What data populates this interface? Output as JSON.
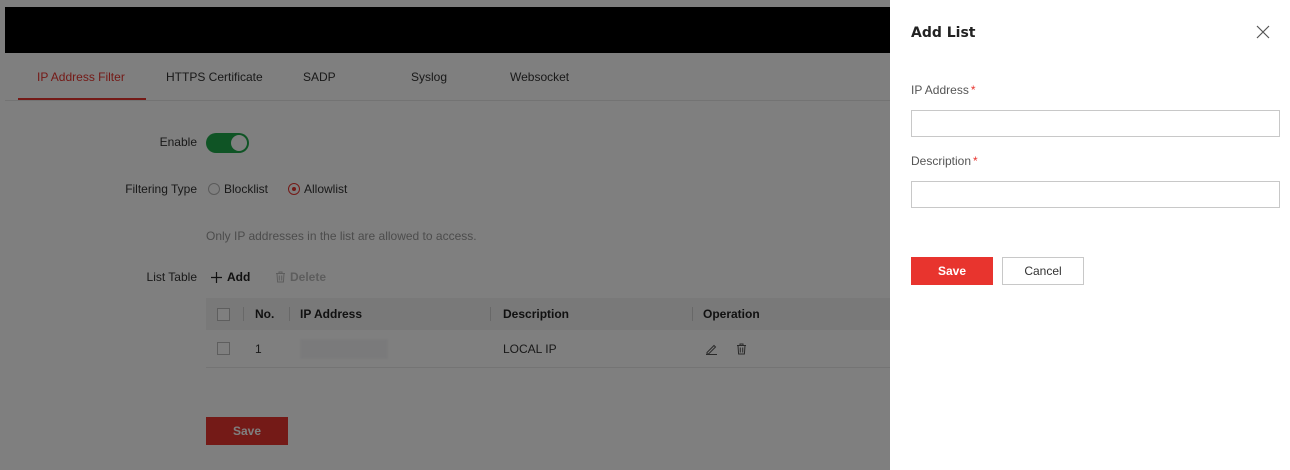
{
  "tabs": [
    {
      "label": "IP Address Filter",
      "active": true
    },
    {
      "label": "HTTPS Certificate",
      "active": false
    },
    {
      "label": "SADP",
      "active": false
    },
    {
      "label": "Syslog",
      "active": false
    },
    {
      "label": "Websocket",
      "active": false
    }
  ],
  "form": {
    "enable_label": "Enable",
    "enable_on": true,
    "filtering_type_label": "Filtering Type",
    "filtering_options": [
      {
        "label": "Blocklist",
        "selected": false
      },
      {
        "label": "Allowlist",
        "selected": true
      }
    ],
    "hint": "Only IP addresses in the list are allowed to access.",
    "list_table_label": "List Table",
    "add_label": "Add",
    "delete_label": "Delete",
    "save_label": "Save"
  },
  "table": {
    "columns": [
      "No.",
      "IP Address",
      "Description",
      "Operation"
    ],
    "rows": [
      {
        "no": "1",
        "ip": "",
        "description": "LOCAL IP"
      }
    ]
  },
  "drawer": {
    "title": "Add List",
    "ip_label": "IP Address",
    "ip_value": "",
    "description_label": "Description",
    "description_value": "",
    "required_mark": "*",
    "save_label": "Save",
    "cancel_label": "Cancel"
  },
  "colors": {
    "accent": "#e8342e",
    "toggle_on": "#1fa84b",
    "topbar": "#000000"
  },
  "icons": [
    "close-icon",
    "plus-icon",
    "trash-icon",
    "edit-icon"
  ]
}
